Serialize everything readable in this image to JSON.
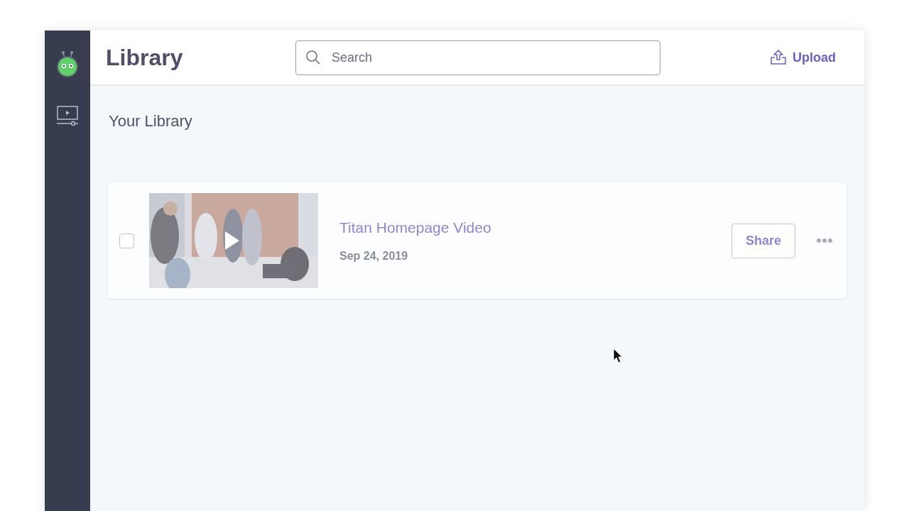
{
  "header": {
    "title": "Library",
    "search": {
      "placeholder": "Search"
    },
    "upload": "Upload"
  },
  "section_title": "Your Library",
  "videos": [
    {
      "title": "Titan Homepage Video",
      "date": "Sep 24, 2019",
      "checked": false,
      "share": "Share"
    }
  ]
}
